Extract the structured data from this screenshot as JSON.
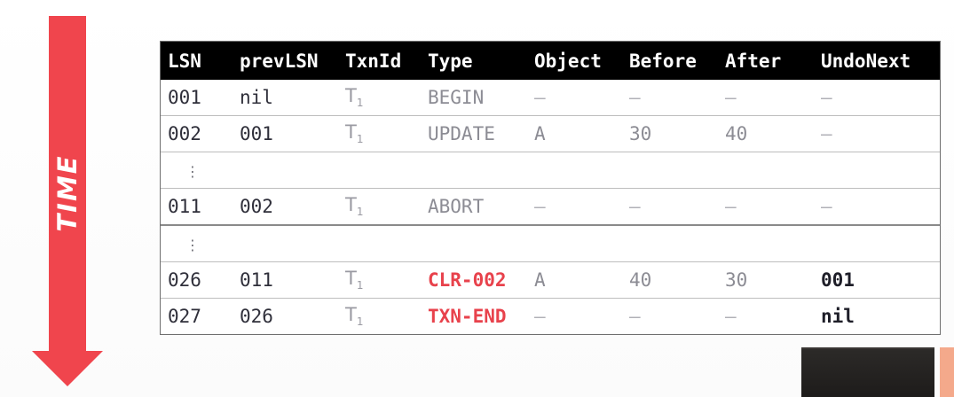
{
  "time_label": "TIME",
  "table": {
    "headers": {
      "lsn": "LSN",
      "prev": "prevLSN",
      "txn": "TxnId",
      "type": "Type",
      "object": "Object",
      "before": "Before",
      "after": "After",
      "undo": "UndoNext"
    },
    "rows": [
      {
        "lsn": "001",
        "prev": "nil",
        "txn_base": "T",
        "txn_sub": "1",
        "type": "BEGIN",
        "object": "–",
        "before": "–",
        "after": "–",
        "undo": "–"
      },
      {
        "lsn": "002",
        "prev": "001",
        "txn_base": "T",
        "txn_sub": "1",
        "type": "UPDATE",
        "object": "A",
        "before": "30",
        "after": "40",
        "undo": "–"
      },
      {
        "ellipsis": "⋮"
      },
      {
        "lsn": "011",
        "prev": "002",
        "txn_base": "T",
        "txn_sub": "1",
        "type": "ABORT",
        "object": "–",
        "before": "–",
        "after": "–",
        "undo": "–"
      },
      {
        "ellipsis": "⋮"
      },
      {
        "lsn": "026",
        "prev": "011",
        "txn_base": "T",
        "txn_sub": "1",
        "type": "CLR-002",
        "object": "A",
        "before": "40",
        "after": "30",
        "undo": "001"
      },
      {
        "lsn": "027",
        "prev": "026",
        "txn_base": "T",
        "txn_sub": "1",
        "type": "TXN-END",
        "object": "–",
        "before": "–",
        "after": "–",
        "undo": "nil"
      }
    ]
  },
  "colors": {
    "arrow": "#f0454d",
    "header_bg": "#000000",
    "clr_text": "#e8424c"
  },
  "icons": {
    "time_arrow": "down-arrow-icon"
  }
}
